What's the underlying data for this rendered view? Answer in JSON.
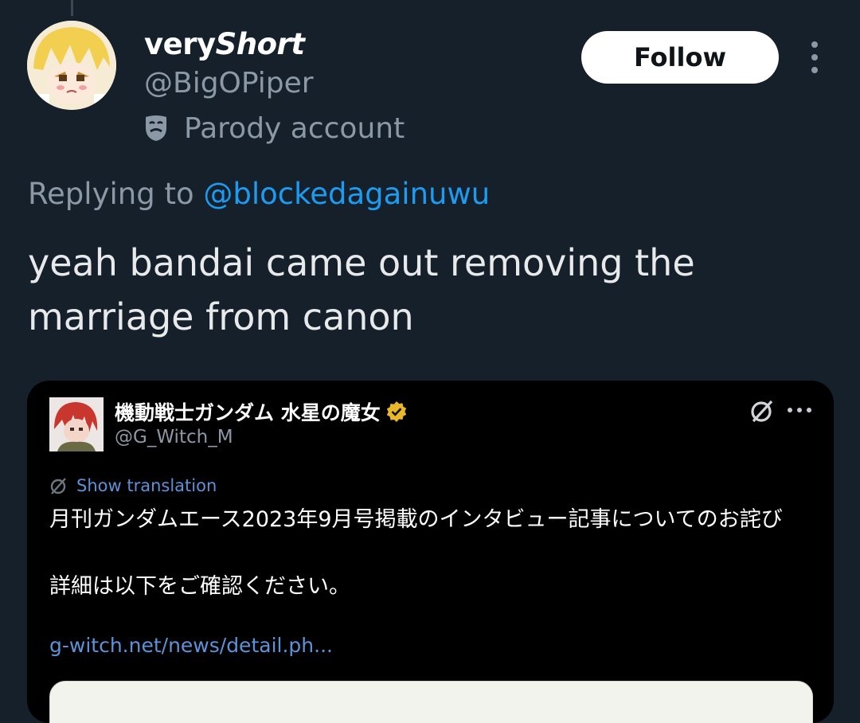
{
  "tweet": {
    "author": {
      "display_name_plain": "very",
      "display_name_styled": "Short",
      "handle": "@BigOPiper",
      "label_icon": "parody-mask-icon",
      "label": "Parody account"
    },
    "follow_label": "Follow",
    "replying_prefix": "Replying to",
    "replying_mention": "@blockedagainuwu",
    "text": "yeah bandai came out removing the marriage from canon"
  },
  "quoted": {
    "author": {
      "display_name": "機動戦士ガンダム 水星の魔女",
      "handle": "@G_Witch_M",
      "verified_icon": "gold-verified-badge-icon"
    },
    "show_translation": "Show translation",
    "body_line1": "月刊ガンダムエース2023年9月号掲載のインタビュー記事についてのお詫び",
    "body_line2": "詳細は以下をご確認ください。",
    "link": "g-witch.net/news/detail.ph..."
  },
  "colors": {
    "background": "#16202b",
    "embed_background": "#000000",
    "accent_link": "#1d9bf0",
    "muted_text": "#8b98a5",
    "verified_gold": "#e8b82a"
  }
}
